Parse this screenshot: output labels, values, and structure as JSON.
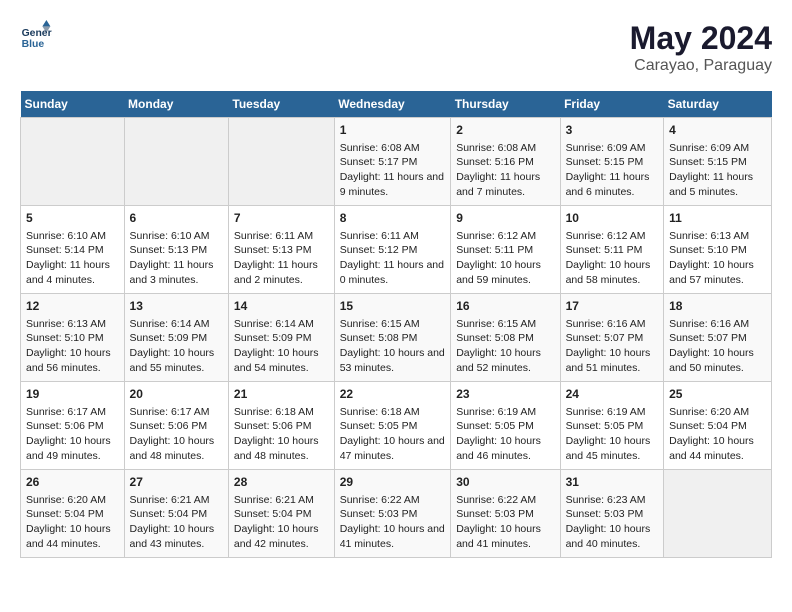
{
  "logo": {
    "line1": "General",
    "line2": "Blue"
  },
  "title": "May 2024",
  "subtitle": "Carayao, Paraguay",
  "days_of_week": [
    "Sunday",
    "Monday",
    "Tuesday",
    "Wednesday",
    "Thursday",
    "Friday",
    "Saturday"
  ],
  "weeks": [
    [
      {
        "day": "",
        "data": ""
      },
      {
        "day": "",
        "data": ""
      },
      {
        "day": "",
        "data": ""
      },
      {
        "day": "1",
        "data": "Sunrise: 6:08 AM\nSunset: 5:17 PM\nDaylight: 11 hours and 9 minutes."
      },
      {
        "day": "2",
        "data": "Sunrise: 6:08 AM\nSunset: 5:16 PM\nDaylight: 11 hours and 7 minutes."
      },
      {
        "day": "3",
        "data": "Sunrise: 6:09 AM\nSunset: 5:15 PM\nDaylight: 11 hours and 6 minutes."
      },
      {
        "day": "4",
        "data": "Sunrise: 6:09 AM\nSunset: 5:15 PM\nDaylight: 11 hours and 5 minutes."
      }
    ],
    [
      {
        "day": "5",
        "data": "Sunrise: 6:10 AM\nSunset: 5:14 PM\nDaylight: 11 hours and 4 minutes."
      },
      {
        "day": "6",
        "data": "Sunrise: 6:10 AM\nSunset: 5:13 PM\nDaylight: 11 hours and 3 minutes."
      },
      {
        "day": "7",
        "data": "Sunrise: 6:11 AM\nSunset: 5:13 PM\nDaylight: 11 hours and 2 minutes."
      },
      {
        "day": "8",
        "data": "Sunrise: 6:11 AM\nSunset: 5:12 PM\nDaylight: 11 hours and 0 minutes."
      },
      {
        "day": "9",
        "data": "Sunrise: 6:12 AM\nSunset: 5:11 PM\nDaylight: 10 hours and 59 minutes."
      },
      {
        "day": "10",
        "data": "Sunrise: 6:12 AM\nSunset: 5:11 PM\nDaylight: 10 hours and 58 minutes."
      },
      {
        "day": "11",
        "data": "Sunrise: 6:13 AM\nSunset: 5:10 PM\nDaylight: 10 hours and 57 minutes."
      }
    ],
    [
      {
        "day": "12",
        "data": "Sunrise: 6:13 AM\nSunset: 5:10 PM\nDaylight: 10 hours and 56 minutes."
      },
      {
        "day": "13",
        "data": "Sunrise: 6:14 AM\nSunset: 5:09 PM\nDaylight: 10 hours and 55 minutes."
      },
      {
        "day": "14",
        "data": "Sunrise: 6:14 AM\nSunset: 5:09 PM\nDaylight: 10 hours and 54 minutes."
      },
      {
        "day": "15",
        "data": "Sunrise: 6:15 AM\nSunset: 5:08 PM\nDaylight: 10 hours and 53 minutes."
      },
      {
        "day": "16",
        "data": "Sunrise: 6:15 AM\nSunset: 5:08 PM\nDaylight: 10 hours and 52 minutes."
      },
      {
        "day": "17",
        "data": "Sunrise: 6:16 AM\nSunset: 5:07 PM\nDaylight: 10 hours and 51 minutes."
      },
      {
        "day": "18",
        "data": "Sunrise: 6:16 AM\nSunset: 5:07 PM\nDaylight: 10 hours and 50 minutes."
      }
    ],
    [
      {
        "day": "19",
        "data": "Sunrise: 6:17 AM\nSunset: 5:06 PM\nDaylight: 10 hours and 49 minutes."
      },
      {
        "day": "20",
        "data": "Sunrise: 6:17 AM\nSunset: 5:06 PM\nDaylight: 10 hours and 48 minutes."
      },
      {
        "day": "21",
        "data": "Sunrise: 6:18 AM\nSunset: 5:06 PM\nDaylight: 10 hours and 48 minutes."
      },
      {
        "day": "22",
        "data": "Sunrise: 6:18 AM\nSunset: 5:05 PM\nDaylight: 10 hours and 47 minutes."
      },
      {
        "day": "23",
        "data": "Sunrise: 6:19 AM\nSunset: 5:05 PM\nDaylight: 10 hours and 46 minutes."
      },
      {
        "day": "24",
        "data": "Sunrise: 6:19 AM\nSunset: 5:05 PM\nDaylight: 10 hours and 45 minutes."
      },
      {
        "day": "25",
        "data": "Sunrise: 6:20 AM\nSunset: 5:04 PM\nDaylight: 10 hours and 44 minutes."
      }
    ],
    [
      {
        "day": "26",
        "data": "Sunrise: 6:20 AM\nSunset: 5:04 PM\nDaylight: 10 hours and 44 minutes."
      },
      {
        "day": "27",
        "data": "Sunrise: 6:21 AM\nSunset: 5:04 PM\nDaylight: 10 hours and 43 minutes."
      },
      {
        "day": "28",
        "data": "Sunrise: 6:21 AM\nSunset: 5:04 PM\nDaylight: 10 hours and 42 minutes."
      },
      {
        "day": "29",
        "data": "Sunrise: 6:22 AM\nSunset: 5:03 PM\nDaylight: 10 hours and 41 minutes."
      },
      {
        "day": "30",
        "data": "Sunrise: 6:22 AM\nSunset: 5:03 PM\nDaylight: 10 hours and 41 minutes."
      },
      {
        "day": "31",
        "data": "Sunrise: 6:23 AM\nSunset: 5:03 PM\nDaylight: 10 hours and 40 minutes."
      },
      {
        "day": "",
        "data": ""
      }
    ]
  ]
}
